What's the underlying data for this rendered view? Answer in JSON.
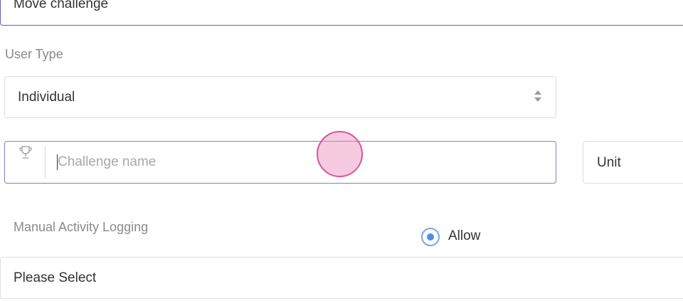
{
  "challenge_type_field": {
    "value": "Move challenge"
  },
  "user_type": {
    "label": "User Type",
    "selected": "Individual"
  },
  "challenge_name": {
    "icon": "trophy-icon",
    "placeholder": "Challenge name",
    "value": ""
  },
  "unit_field": {
    "value": "Unit"
  },
  "manual_logging": {
    "label": "Manual Activity Logging",
    "option_label": "Allow",
    "option_selected": true,
    "select_value": "Please Select"
  },
  "colors": {
    "focus_border": "#7c82c9",
    "radio_accent": "#4d8fe8",
    "touch_indicator": "#d9549a"
  }
}
